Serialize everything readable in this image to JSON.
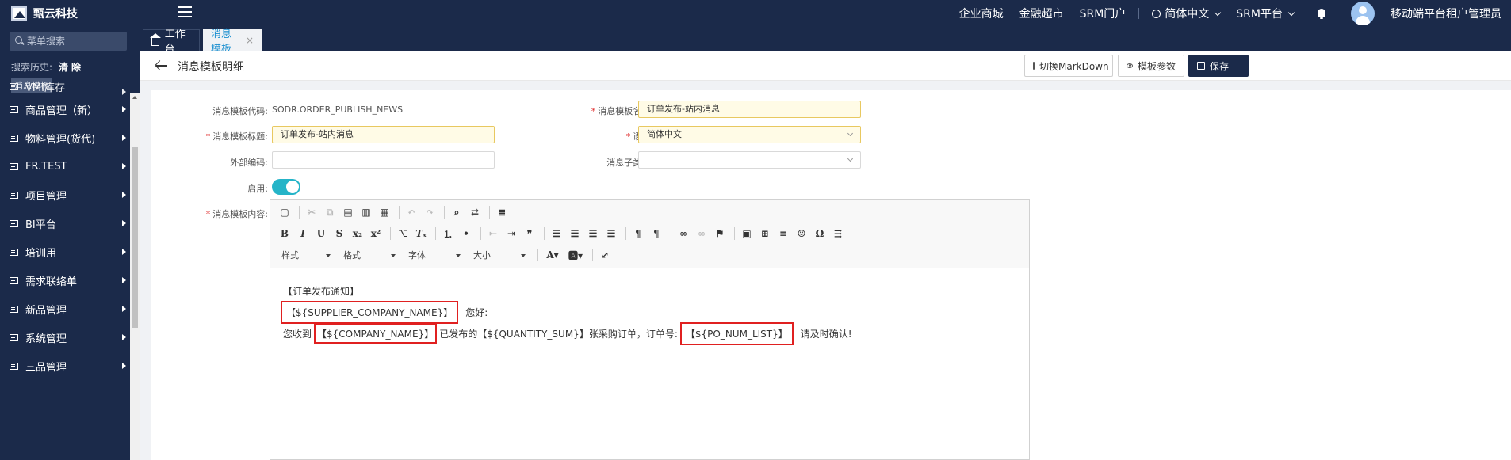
{
  "app": {
    "name": "甄云科技"
  },
  "topnav": {
    "items": [
      "企业商城",
      "金融超市",
      "SRM门户"
    ],
    "language": "简体中文",
    "platform": "SRM平台",
    "user": "移动端平台租户管理员"
  },
  "sidebar": {
    "search_placeholder": "菜单搜索",
    "history_label": "搜索历史:",
    "clear_label": "清除",
    "history_tag": "消息模板",
    "items": [
      "VMI库存",
      "商品管理（新）",
      "物料管理(货代)",
      "FR.TEST",
      "项目管理",
      "BI平台",
      "培训用",
      "需求联络单",
      "新品管理",
      "系统管理",
      "三品管理"
    ]
  },
  "tabs": {
    "home": "工作台",
    "active": "消息模板"
  },
  "page": {
    "title": "消息模板明细",
    "buttons": {
      "markdown": "切换MarkDown",
      "params": "模板参数",
      "save": "保存"
    }
  },
  "form": {
    "code_label": "消息模板代码:",
    "code_value": "SODR.ORDER_PUBLISH_NEWS",
    "name_label": "消息模板名称:",
    "name_value": "订单发布-站内消息",
    "title_label": "消息模板标题:",
    "title_value": "订单发布-站内消息",
    "lang_label": "语言:",
    "lang_value": "简体中文",
    "ext_label": "外部编码:",
    "ext_value": "",
    "subtype_label": "消息子类型:",
    "subtype_value": "",
    "enable_label": "启用:",
    "enabled": true,
    "content_label": "消息模板内容:"
  },
  "editor": {
    "combos": {
      "styles": "样式",
      "format": "格式",
      "font": "字体",
      "size": "大小"
    },
    "content": {
      "line1": "【订单发布通知】",
      "line2_var": "【${SUPPLIER_COMPANY_NAME}】",
      "line2_text": "您好:",
      "line3_pre": "您收到",
      "line3_var1": "【${COMPANY_NAME}】",
      "line3_mid": "已发布的【${QUANTITY_SUM}】张采购订单，订单号:",
      "line3_var2": "【${PO_NUM_LIST}】",
      "line3_post": "请及时确认!"
    }
  },
  "colors": {
    "nav_bg": "#1b2a4a",
    "accent": "#1a8fd0",
    "toggle": "#25b4c8",
    "highlight_box": "#e02020"
  }
}
